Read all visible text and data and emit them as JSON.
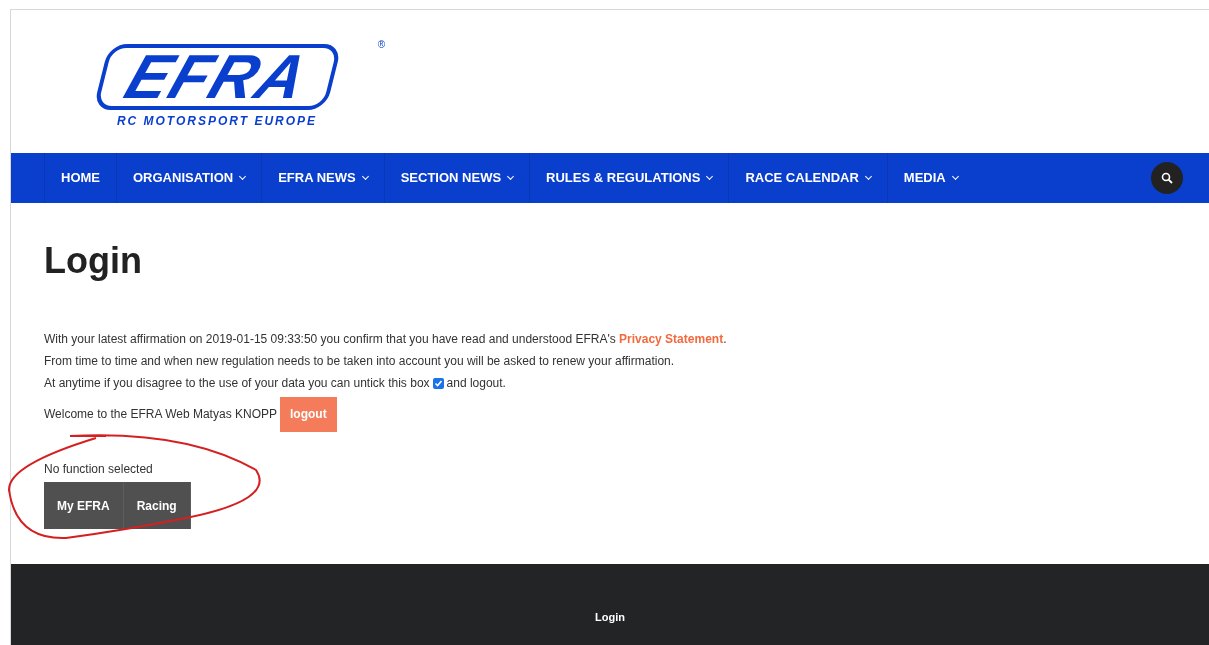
{
  "logo": {
    "wordmark": "EFRA",
    "registered": "®",
    "tagline": "RC MOTORSPORT EUROPE"
  },
  "nav": {
    "items": [
      {
        "label": "HOME",
        "has_dropdown": false
      },
      {
        "label": "ORGANISATION",
        "has_dropdown": true
      },
      {
        "label": "EFRA NEWS",
        "has_dropdown": true
      },
      {
        "label": "SECTION NEWS",
        "has_dropdown": true
      },
      {
        "label": "RULES & REGULATIONS",
        "has_dropdown": true
      },
      {
        "label": "RACE CALENDAR",
        "has_dropdown": true
      },
      {
        "label": "MEDIA",
        "has_dropdown": true
      }
    ]
  },
  "page": {
    "title": "Login",
    "affirmation": {
      "text": "With your latest affirmation on 2019-01-15 09:33:50 you confirm that you have read and understood EFRA's",
      "link": "Privacy Statement",
      "end": "."
    },
    "renew_note": "From time to time and when new regulation needs to be taken into account you will be asked to renew your affirmation.",
    "consent": {
      "before": "At anytime if you disagree to the use of your data you can untick this box",
      "checked": true,
      "after": "and logout."
    },
    "welcome": "Welcome to the EFRA Web Matyas KNOPP",
    "logout_button": "logout",
    "function_status": "No function selected",
    "function_buttons": [
      "My EFRA",
      "Racing"
    ]
  },
  "footer": {
    "label": "Login"
  }
}
